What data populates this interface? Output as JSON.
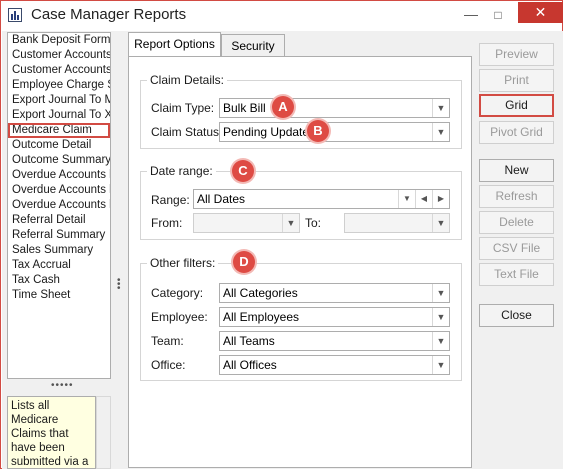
{
  "window": {
    "title": "Case Manager Reports"
  },
  "report_list": [
    "Bank Deposit Form",
    "Customer Accounts",
    "Customer Accounts",
    "Employee Charge S",
    "Export Journal To M",
    "Export Journal To X",
    "Medicare Claim",
    "Outcome Detail",
    "Outcome Summary",
    "Overdue Accounts l",
    "Overdue Accounts l",
    "Overdue Accounts l",
    "Referral Detail",
    "Referral Summary",
    "Sales Summary",
    "Tax Accrual",
    "Tax Cash",
    "Time Sheet"
  ],
  "selected_report": "Medicare Claim",
  "description": "Lists all Medicare Claims that have been submitted via a case invoice.",
  "tabs": {
    "report_options": "Report Options",
    "security": "Security"
  },
  "claim_details": {
    "group_label": "Claim Details:",
    "type_label": "Claim Type:",
    "type_value": "Bulk Bill",
    "status_label": "Claim Status:",
    "status_value": "Pending Update"
  },
  "date_range": {
    "group_label": "Date range:",
    "range_label": "Range:",
    "range_value": "All Dates",
    "from_label": "From:",
    "from_value": "",
    "to_label": "To:",
    "to_value": ""
  },
  "other_filters": {
    "group_label": "Other filters:",
    "category_label": "Category:",
    "category_value": "All Categories",
    "employee_label": "Employee:",
    "employee_value": "All Employees",
    "team_label": "Team:",
    "team_value": "All Teams",
    "office_label": "Office:",
    "office_value": "All Offices"
  },
  "badges": {
    "a": "A",
    "b": "B",
    "c": "C",
    "d": "D"
  },
  "buttons": {
    "preview": "Preview",
    "print": "Print",
    "grid": "Grid",
    "pivot_grid": "Pivot Grid",
    "new": "New",
    "refresh": "Refresh",
    "delete": "Delete",
    "csv_file": "CSV File",
    "text_file": "Text File",
    "close": "Close"
  },
  "colors": {
    "highlight": "#d24b43",
    "badge": "#de4b44",
    "close_button": "#c7372f",
    "description_bg": "#ffffe1"
  }
}
